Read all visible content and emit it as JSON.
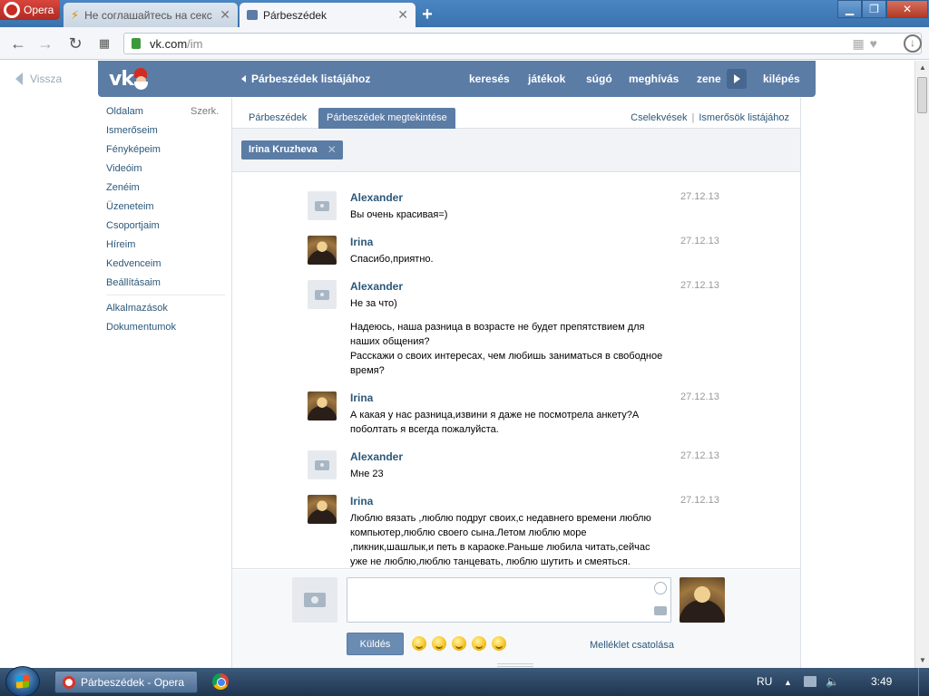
{
  "browser": {
    "menu_label": "Opera",
    "tabs": [
      {
        "label": "Не соглашайтесь на секс"
      },
      {
        "label": "Párbeszédek"
      }
    ],
    "url_host": "vk.com",
    "url_path": "/im"
  },
  "page": {
    "back_label": "Vissza",
    "header": {
      "back_to_list": "Párbeszédek listájához",
      "nav": [
        "keresés",
        "játékok",
        "súgó",
        "meghívás",
        "zene",
        "kilépés"
      ]
    },
    "left_menu": {
      "edit_label": "Szerk.",
      "items": [
        "Oldalam",
        "Ismerőseim",
        "Fényképeim",
        "Videóim",
        "Zenéim",
        "Üzeneteim",
        "Csoportjaim",
        "Híreim",
        "Kedvenceim",
        "Beállításaim"
      ],
      "extra_items": [
        "Alkalmazások",
        "Dokumentumok"
      ]
    },
    "tabs": {
      "dialogs": "Párbeszédek",
      "view": "Párbeszédek megtekintése",
      "actions": "Cselekvések",
      "to_friends": "Ismerősök listájához"
    },
    "peer_name": "Irina Kruzheva",
    "messages": [
      {
        "author": "Alexander",
        "date": "27.12.13",
        "avatar": "camera",
        "paragraphs": [
          "Вы очень красивая=)"
        ]
      },
      {
        "author": "Irina",
        "date": "27.12.13",
        "avatar": "photo",
        "paragraphs": [
          "Спасибо,приятно."
        ]
      },
      {
        "author": "Alexander",
        "date": "27.12.13",
        "avatar": "camera",
        "paragraphs": [
          "Не за что)",
          "Надеюсь, наша разница в возрасте не будет препятствием для наших общения?\nРасскажи о своих интересах, чем любишь заниматься в свободное время?"
        ]
      },
      {
        "author": "Irina",
        "date": "27.12.13",
        "avatar": "photo",
        "paragraphs": [
          "А какая у нас разница,извини я даже не посмотрела анкету?А поболтать я всегда пожалуйста."
        ]
      },
      {
        "author": "Alexander",
        "date": "27.12.13",
        "avatar": "camera",
        "paragraphs": [
          "Мне 23"
        ]
      },
      {
        "author": "Irina",
        "date": "27.12.13",
        "avatar": "photo",
        "paragraphs": [
          "Люблю вязать ,люблю подруг своих,с недавнего времени люблю компьютер,люблю своего сына.Летом люблю море ,пикник,шашлык,и петь в караоке.Раньше любила читать,сейчас уже не люблю,люблю танцевать, люблю шутить и смеяться."
        ]
      }
    ],
    "composer": {
      "send_label": "Küldés",
      "attach_label": "Melléklet csatolása",
      "emoji_count": 5
    }
  },
  "taskbar": {
    "active_window": "Párbeszédek - Opera",
    "language": "RU",
    "clock": "3:49"
  }
}
